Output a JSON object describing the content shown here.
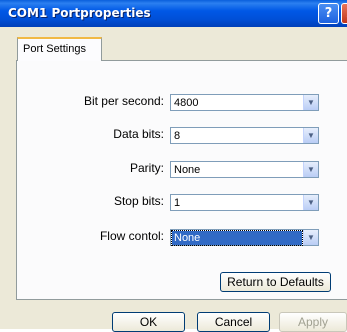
{
  "window": {
    "title": "COM1 Portproperties",
    "help_glyph": "?",
    "close_glyph": "X"
  },
  "tabs": [
    {
      "label": "Port Settings"
    }
  ],
  "fields": [
    {
      "label": "Bit per second:",
      "value": "4800"
    },
    {
      "label": "Data bits:",
      "value": "8"
    },
    {
      "label": "Parity:",
      "value": "None"
    },
    {
      "label": "Stop bits:",
      "value": "1"
    },
    {
      "label": "Flow contol:",
      "value": "None"
    }
  ],
  "buttons": {
    "restore": "Return to Defaults",
    "ok": "OK",
    "cancel": "Cancel",
    "apply": "Apply"
  },
  "icons": {
    "dropdown_arrow": "chevron-down-icon"
  }
}
